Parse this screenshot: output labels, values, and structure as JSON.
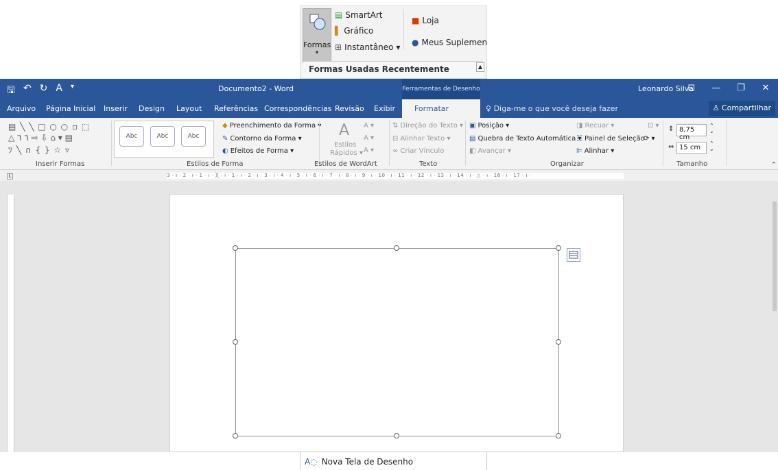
{
  "insert_ribbon": {
    "formas_label": "Formas",
    "smartart_label": "SmartArt",
    "grafico_label": "Gráfico",
    "instantaneo_label": "Instantâneo ▾",
    "loja_label": "Loja",
    "suplementos_label": "Meus Suplemen",
    "recent_shapes_header": "Formas Usadas Recentemente",
    "nova_tela_label": "Nova Tela de Desenho"
  },
  "titlebar": {
    "document_title": "Documento2 - Word",
    "context_title": "Ferramentas de Desenho",
    "user_name": "Leonardo Silva"
  },
  "tabs": [
    {
      "label": "Arquivo"
    },
    {
      "label": "Página Inicial"
    },
    {
      "label": "Inserir"
    },
    {
      "label": "Design"
    },
    {
      "label": "Layout"
    },
    {
      "label": "Referências"
    },
    {
      "label": "Correspondências"
    },
    {
      "label": "Revisão"
    },
    {
      "label": "Exibir"
    },
    {
      "label": "Formatar"
    }
  ],
  "tell_me": "Diga-me o que você deseja fazer",
  "share_label": "Compartilhar",
  "ribbon": {
    "groups": {
      "inserir_formas": "Inserir Formas",
      "estilos_forma": "Estilos de Forma",
      "estilos_wordart": "Estilos de WordArt",
      "texto": "Texto",
      "organizar": "Organizar",
      "tamanho": "Tamanho"
    },
    "abc_label": "Abc",
    "preenchimento": "Preenchimento da Forma ▾",
    "contorno": "Contorno da Forma ▾",
    "efeitos": "Efeitos de Forma ▾",
    "estilos_rapidos_1": "Estilos",
    "estilos_rapidos_2": "Rápidos ▾",
    "direcao_texto": "Direção do Texto ▾",
    "alinhar_texto": "Alinhar Texto ▾",
    "criar_vinculo": "Criar Vínculo",
    "posicao": "Posição ▾",
    "quebra_texto": "Quebra de Texto Automática ▾",
    "avancar": "Avançar ▾",
    "recuar": "Recuar ▾",
    "painel_selecao": "Painel de Seleção",
    "alinhar": "Alinhar ▾",
    "height_value": "8,75 cm",
    "width_value": "15 cm"
  },
  "ruler_text": "3 · ı · 2 · ı · 1 · ı · ╳ · ı · 1 · ı · 2 · ı · 3 · ı · 4 · ı · 5 · ı · 6 · ı · 7 · ı · 8 · ı · 9 · ı · 10 · ı · 11 · ı · 12 · ı · 13 · ı · 14 · ı · △ · ı · 16 · ı · 17 · ı ·",
  "ruler_corner": "L",
  "colors": {
    "word_blue": "#2b579a",
    "ribbon_bg": "#f3f3f3",
    "workspace_bg": "#e6e6e6"
  }
}
